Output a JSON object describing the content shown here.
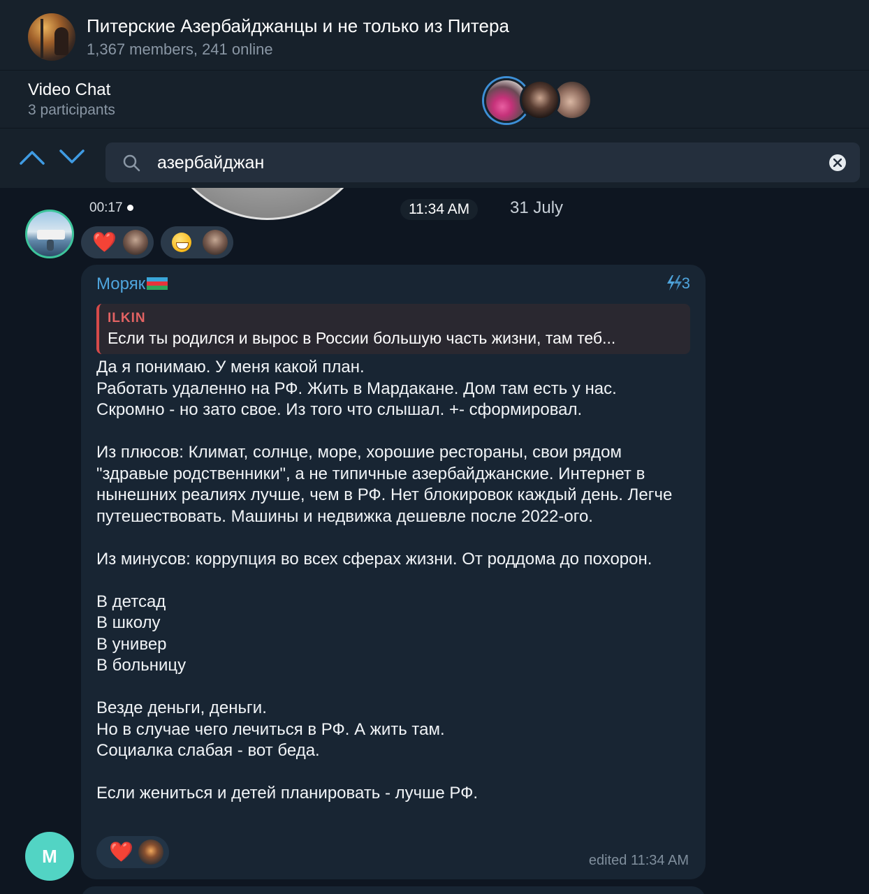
{
  "header": {
    "title": "Питерские Азербайджанцы и не только из Питера",
    "subtitle": "1,367 members, 241 online"
  },
  "video_chat": {
    "title": "Video Chat",
    "participants": "3 participants"
  },
  "search": {
    "query": "азербайджан"
  },
  "previous_message": {
    "duration": "00:17",
    "time": "11:34 AM",
    "date": "31 July",
    "reactions": [
      {
        "emoji": "❤️",
        "icon": "heart-emoji"
      },
      {
        "emoji": "😁",
        "icon": "grinning-emoji"
      }
    ]
  },
  "message": {
    "sender": "Моряк",
    "sender_flag": "azerbaijan-flag",
    "boost_count": "3",
    "reply": {
      "author": "ILKIN",
      "text": "Если ты родился и вырос в России большую часть жизни, там теб..."
    },
    "text": "Да я понимаю. У меня какой план.\nРаботать удаленно на РФ. Жить в Мардакане. Дом там есть у нас.\nСкромно - но зато свое. Из того что слышал. +- сформировал.\n\nИз плюсов: Климат, солнце, море, хорошие рестораны, свои рядом \"здравые родственники\", а не типичные азербайджанские. Интернет в нынешних реалиях лучше, чем в РФ. Нет блокировок каждый день. Легче путешествовать. Машины и недвижка дешевле после 2022-ого.\n\nИз минусов: коррупция во всех сферах жизни. От роддома до похорон.\n\nВ детсад\nВ школу\nВ универ\nВ больницу\n\nВезде деньги, деньги.\nНо в случае чего лечиться в РФ. А жить там.\nСоциалка слабая - вот беда.\n\nЕсли жениться и детей планировать - лучше РФ.",
    "reaction": "❤️",
    "edited": "edited 11:34 AM",
    "avatar_letter": "M"
  },
  "colors": {
    "background": "#0e1621",
    "panel": "#17212b",
    "bubble": "#182533",
    "accent": "#4fa5dd",
    "reply_accent": "#d64a4a",
    "avatar_m": "#52d4c4"
  }
}
